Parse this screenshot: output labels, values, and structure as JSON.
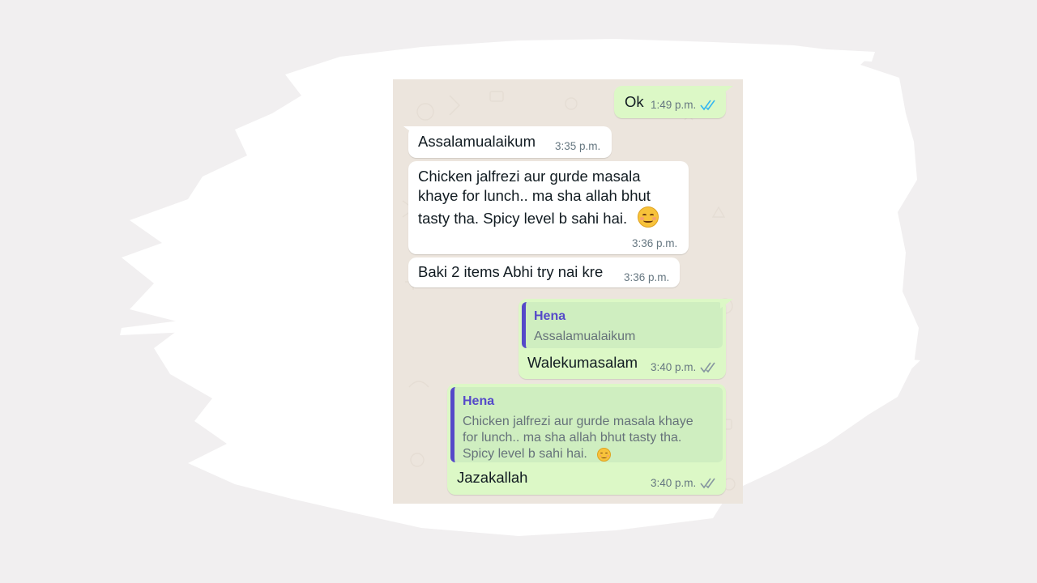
{
  "messages": [
    {
      "direction": "outgoing",
      "text": "Ok",
      "time": "1:49 p.m.",
      "status": "read",
      "tick_color": "#34b7f1"
    },
    {
      "direction": "incoming",
      "text": "Assalamualaikum",
      "time": "3:35 p.m."
    },
    {
      "direction": "incoming",
      "lines": [
        "Chicken jalfrezi aur gurde masala",
        "khaye for lunch.. ma sha allah bhut",
        "tasty tha. Spicy level b sahi hai."
      ],
      "emoji": "smiling-face-icon",
      "time": "3:36 p.m."
    },
    {
      "direction": "incoming",
      "text": "Baki 2 items Abhi try nai kre",
      "time": "3:36 p.m."
    },
    {
      "direction": "outgoing",
      "reply": {
        "name": "Hena",
        "lines": [
          "Assalamualaikum"
        ]
      },
      "text": "Walekumasalam",
      "time": "3:40 p.m.",
      "status": "delivered",
      "tick_color": "#8696a0"
    },
    {
      "direction": "outgoing",
      "reply": {
        "name": "Hena",
        "lines": [
          "Chicken jalfrezi aur gurde masala khaye",
          "for lunch.. ma sha allah bhut tasty tha.",
          "Spicy level b sahi hai."
        ],
        "emoji": "smiling-face-icon"
      },
      "text": "Jazakallah",
      "time": "3:40 p.m.",
      "status": "delivered",
      "tick_color": "#8696a0"
    }
  ],
  "colors": {
    "incoming_bubble": "#ffffff",
    "outgoing_bubble": "#dcf8c6",
    "chat_background": "#ece5dd",
    "reply_accent": "#5549c9"
  }
}
